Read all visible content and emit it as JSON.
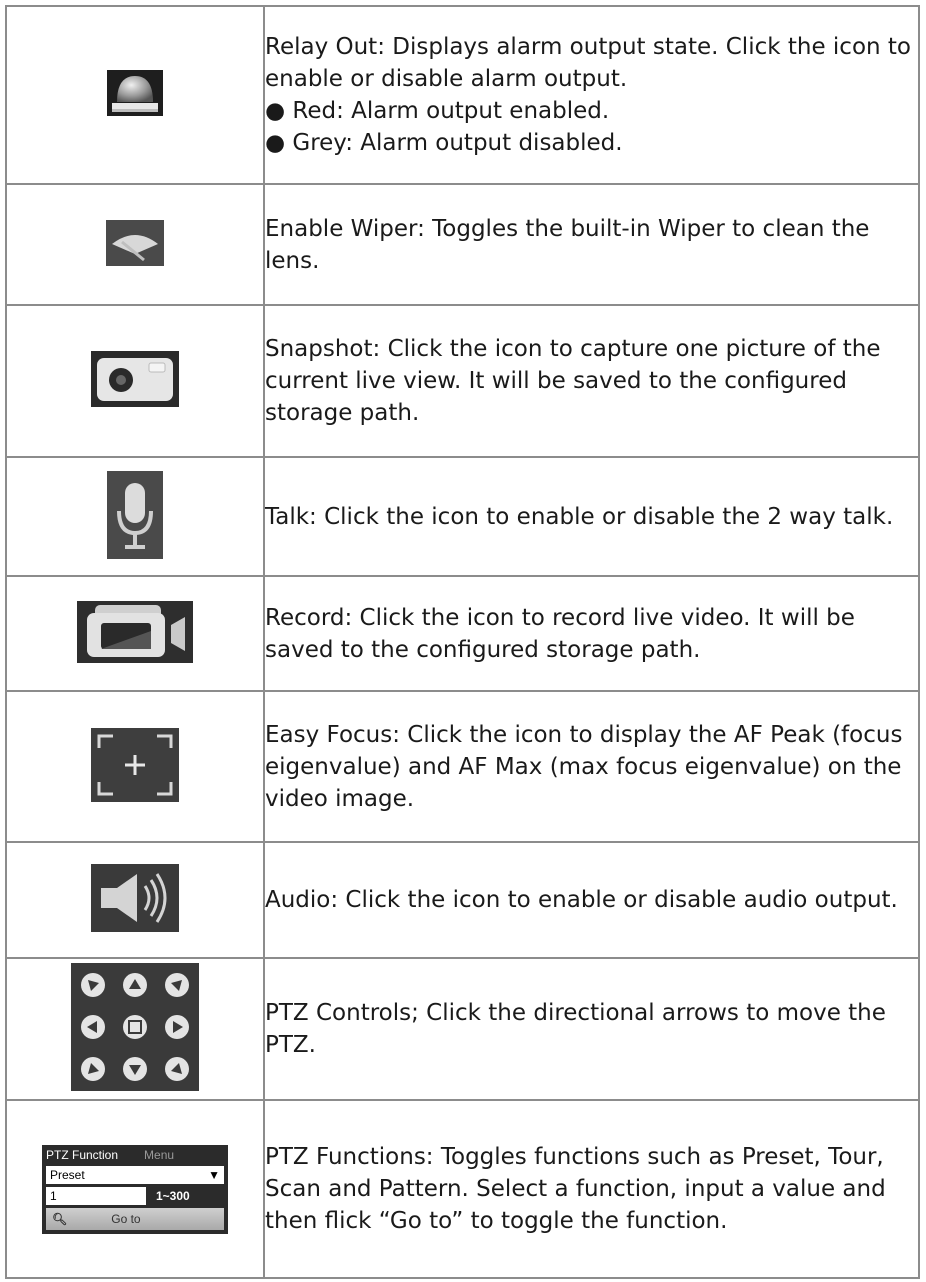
{
  "rows": [
    {
      "icon": "relay-out-icon",
      "text": "Relay Out: Displays alarm output state. Click the icon to enable or disable alarm output.",
      "bullets": [
        "● Red: Alarm output enabled.",
        "● Grey: Alarm output disabled."
      ]
    },
    {
      "icon": "wiper-icon",
      "text": "Enable Wiper: Toggles the built-in Wiper to clean the lens."
    },
    {
      "icon": "camera-icon",
      "text": "Snapshot: Click the icon to capture one picture of the current live view. It will be saved to the configured storage path."
    },
    {
      "icon": "microphone-icon",
      "text": "Talk: Click the icon to enable or disable the 2 way talk."
    },
    {
      "icon": "video-camera-icon",
      "text": "Record: Click the icon to record live video. It will be saved to the configured storage path."
    },
    {
      "icon": "focus-frame-icon",
      "text": "Easy Focus: Click the icon to display the AF Peak (focus eigenvalue) and AF Max (max focus eigenvalue) on the video image."
    },
    {
      "icon": "speaker-icon",
      "text": "Audio: Click the icon to enable or disable audio output."
    },
    {
      "icon": "ptz-arrows-icon",
      "text": "PTZ Controls; Click the directional arrows to move the PTZ."
    },
    {
      "icon": "ptz-function-panel",
      "text": "PTZ Functions: Toggles functions such as Preset, Tour, Scan and Pattern. Select a function, input a value and then flick “Go to” to toggle the function."
    }
  ],
  "ptz_panel": {
    "tab_active": "PTZ Function",
    "tab_menu": "Menu",
    "select_value": "Preset",
    "input_value": "1",
    "range": "1~300",
    "goto_label": "Go to"
  }
}
